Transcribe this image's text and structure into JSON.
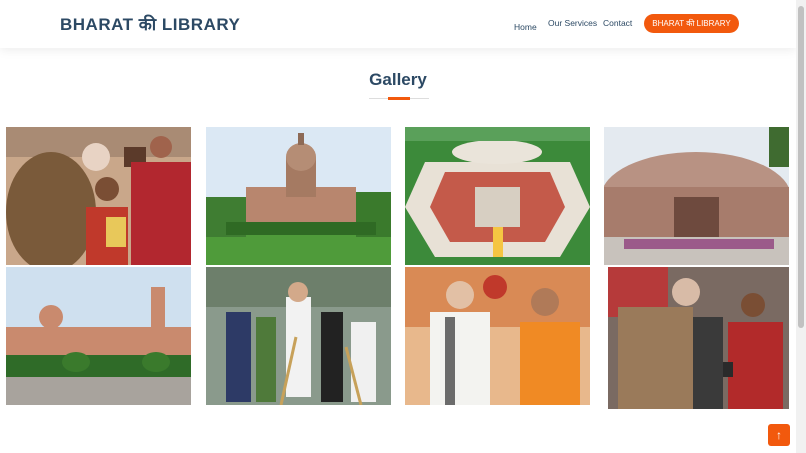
{
  "header": {
    "logo": "BHARAT की LIBRARY",
    "nav": [
      "Home",
      "Our Services",
      "Contact"
    ],
    "cta_label": "BHARAT की LIBRARY"
  },
  "gallery": {
    "title": "Gallery",
    "items": [
      {
        "name": "gallery-photo-leader-with-children",
        "subject": "leader greeting children"
      },
      {
        "name": "gallery-photo-supreme-court",
        "subject": "Supreme Court building"
      },
      {
        "name": "gallery-photo-new-parliament",
        "subject": "New Parliament building rendering"
      },
      {
        "name": "gallery-photo-old-parliament",
        "subject": "Parliament House"
      },
      {
        "name": "gallery-photo-secretariat",
        "subject": "Secretariat building"
      },
      {
        "name": "gallery-photo-cleanliness-drive",
        "subject": "cleanliness drive with brooms"
      },
      {
        "name": "gallery-photo-two-leaders",
        "subject": "two leaders standing"
      },
      {
        "name": "gallery-photo-leader-with-student",
        "subject": "leader with student and tablet"
      }
    ]
  },
  "colors": {
    "accent": "#f2590d",
    "heading": "#2c4964"
  },
  "icons": {
    "back_to_top": "arrow-up-icon"
  },
  "back_to_top_glyph": "↑"
}
